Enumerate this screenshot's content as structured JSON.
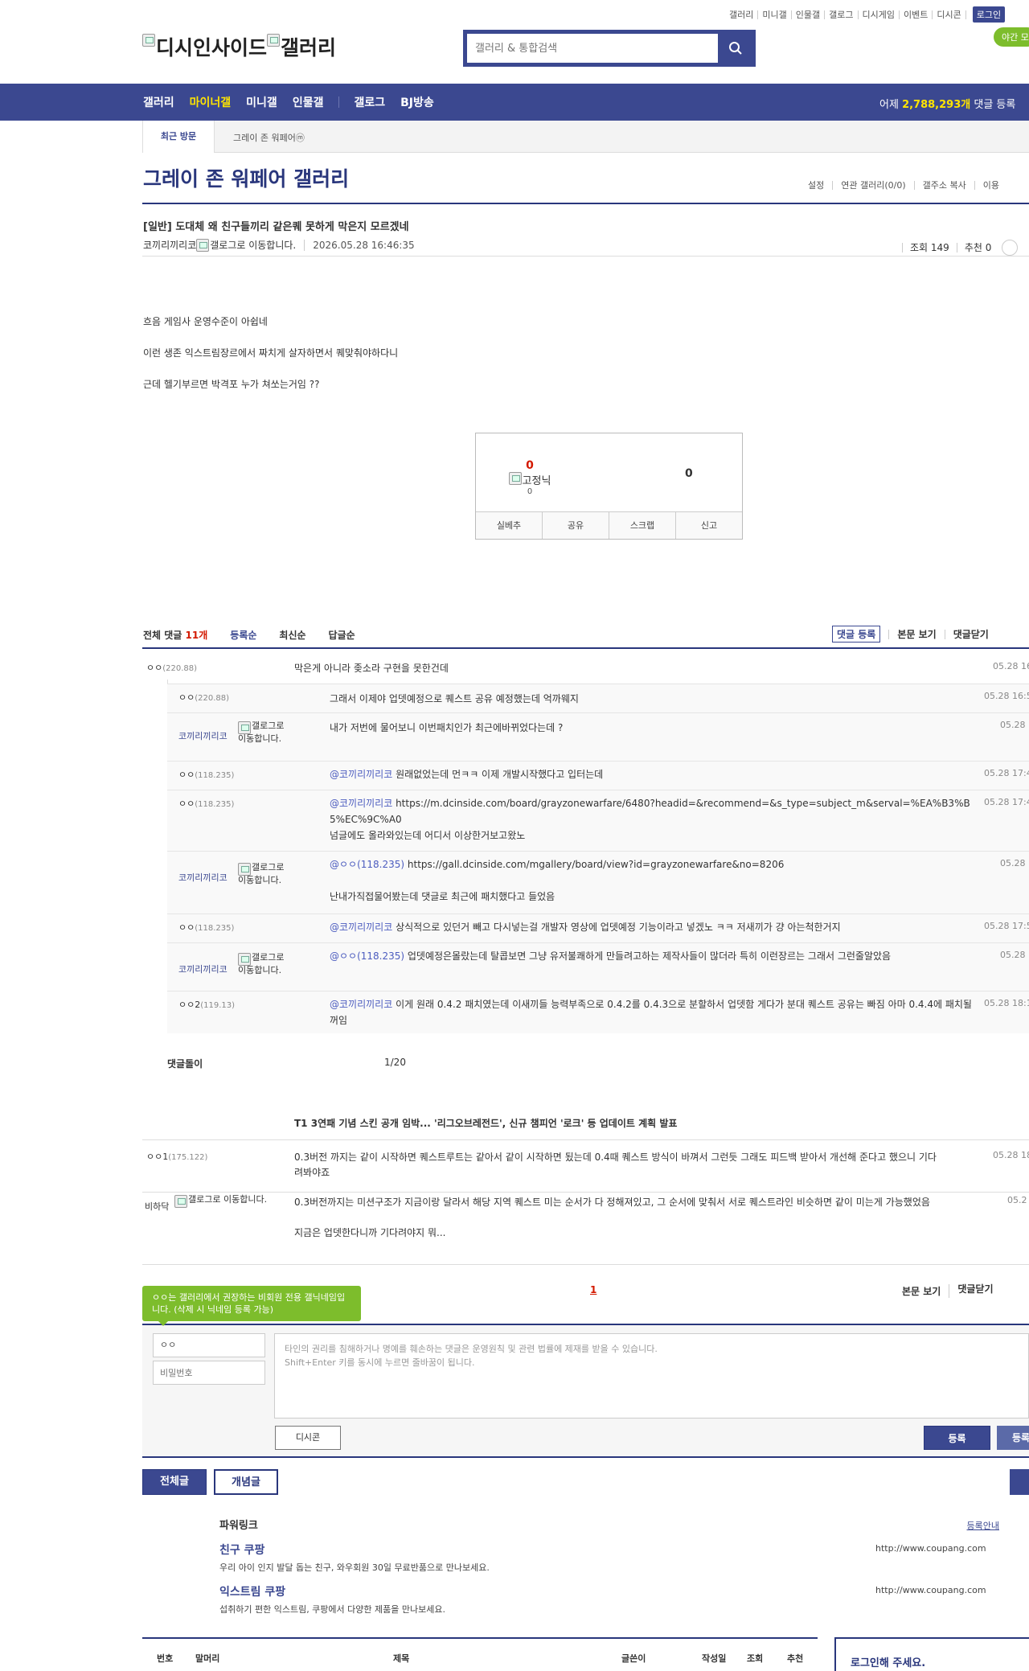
{
  "top_util": {
    "items": [
      "갤러리",
      "미니갤",
      "인물갤",
      "갤로그",
      "디시게임",
      "이벤트",
      "디시콘"
    ],
    "login": "로그인",
    "night_mode": "야간 모"
  },
  "logo": {
    "left_alt": "디시인사이드",
    "right_alt": "갤러리"
  },
  "search": {
    "placeholder": "갤러리 & 통합검색"
  },
  "gnb": {
    "menu": [
      "갤러리",
      "마이너갤",
      "미니갤",
      "인물갤",
      "갤로그",
      "BJ방송"
    ],
    "stats_prefix": "어제",
    "stats_count": "2,788,293개",
    "stats_suffix": "댓글 등록"
  },
  "recent_visit": {
    "title": "최근 방문",
    "item": "그레이 존 워페어ⓜ"
  },
  "gallery": {
    "title": "그레이 존 워페어 갤러리",
    "options": [
      "설정",
      "연관 갤러리(0/0)",
      "갤주소 복사",
      "이용"
    ]
  },
  "post": {
    "title": "[일반] 도대체 왜 친구들끼리 같은퀘 못하게 막은지 모르겠네",
    "author": "코끼리끼리코",
    "gallog_alt": "갤로그로 이동합니다.",
    "date": "2026.05.28 16:46:35",
    "views": "조회 149",
    "recommend": "추천 0",
    "body": [
      "흐음 게임사 운영수준이 아쉽네",
      "이런 생존 익스트림장르에서 짜치게 살자하면서 퀘맞춰야하다니",
      "근데 헬기부르면 박격포 누가 쳐쏘는거임 ??"
    ]
  },
  "recommend_box": {
    "up_count": "0",
    "fixed_nick_alt": "고정닉",
    "fixed_count": "0",
    "down_count": "0",
    "buttons": [
      "실베추",
      "공유",
      "스크랩",
      "신고"
    ]
  },
  "comments_header": {
    "label": "전체 댓글",
    "count": "11개",
    "sorts": [
      "등록순",
      "최신순",
      "답글순"
    ],
    "register": "댓글 등록",
    "view_body": "본문 보기",
    "close": "댓글닫기"
  },
  "comments": [
    {
      "nick": "ㅇㅇ",
      "ip": "(220.88)",
      "text": "막은게 아니라 좆소라 구현을 못한건데",
      "date": "05.28 16"
    }
  ],
  "replies": [
    {
      "nick": "ㅇㅇ",
      "ip": "(220.88)",
      "member": false,
      "mention": "",
      "text": "그래서 이제야 업뎃예정으로 퀘스트 공유 예정했는데 억까웨지",
      "date": "05.28 16:5"
    },
    {
      "nick": "코끼리끼리코",
      "ip": "",
      "member": true,
      "mention": "",
      "text": "내가 저번에 물어보니 이번패치인가 최근에바뀌었다는데 ?",
      "date": "05.28"
    },
    {
      "nick": "ㅇㅇ",
      "ip": "(118.235)",
      "member": false,
      "mention": "@코끼리끼리코",
      "text": " 원래없었는데 먼ㅋㅋ 이제 개발시작했다고 입터는데",
      "date": "05.28 17:4"
    },
    {
      "nick": "ㅇㅇ",
      "ip": "(118.235)",
      "member": false,
      "mention": "@코끼리끼리코",
      "text": " https://m.dcinside.com/board/grayzonewarfare/6480?headid=&recommend=&s_type=subject_m&serval=%EA%B3%B5%EC%9C%A0",
      "text2": "넘글에도 올라와있는데 어디서 이상한거보고왔노",
      "date": "05.28 17:4"
    },
    {
      "nick": "코끼리끼리코",
      "ip": "",
      "member": true,
      "mention": "@ㅇㅇ(118.235)",
      "text": " https://gall.dcinside.com/mgallery/board/view?id=grayzonewarfare&no=8206",
      "text2": "난내가직접물어봤는데 댓글로 최근에 패치했다고 들었음",
      "date": "05.28"
    },
    {
      "nick": "ㅇㅇ",
      "ip": "(118.235)",
      "member": false,
      "mention": "@코끼리끼리코",
      "text": " 상식적으로 있던거 빼고 다시넣는걸 개발자 영상에 업뎃예정 기능이라고 넣겠노 ㅋㅋ 저새끼가 걍 아는척한거지",
      "date": "05.28 17:5"
    },
    {
      "nick": "코끼리끼리코",
      "ip": "",
      "member": true,
      "mention": "@ㅇㅇ(118.235)",
      "text": " 업뎃예정은몰랐는데 탈콥보면 그냥 유저불쾌하게 만들려고하는 제작사들이 많더라 특히 이런장르는 그래서 그런줄알았음",
      "date": "05.28"
    },
    {
      "nick": "ㅇㅇ2",
      "ip": "(119.13)",
      "member": false,
      "mention": "@코끼리끼리코",
      "text": " 이게 원래 0.4.2 패치였는데 이새끼들 능력부족으로 0.4.2를 0.4.3으로 분할하서 업뎃함 게다가 분대 퀘스트 공유는 빠짐 아마 0.4.4에 패치될꺼임",
      "date": "05.28 18:1"
    }
  ],
  "dolly": {
    "label": "댓글돌이",
    "page": "1/20"
  },
  "news": {
    "title": "T1 3연패 기념 스킨 공개 임박... '리그오브레전드', 신규 챔피언 '로크' 등 업데이트 계획 발표"
  },
  "comments2": [
    {
      "nick": "ㅇㅇ1",
      "ip": "(175.122)",
      "text": "0.3버전 까지는 같이 시작하면 퀘스트루트는 같아서 같이 시작하면 됬는데 0.4때 퀘스트 방식이 바껴서 그런듯 그래도 피드백 받아서 개선해 준다고 했으니 기다려봐야죠",
      "date": "05.28 18"
    },
    {
      "nick": "비하닥",
      "ip": "",
      "gallog_alt": "갤로그로 이동합니다.",
      "text": "0.3버전까지는 미션구조가 지금이랑 달라서 해당 지역 퀘스트 미는 순서가 다 정해져있고, 그 순서에 맞춰서 서로 퀘스트라인 비슷하면 같이 미는게 가능했었음",
      "text2": "지금은 업뎃한다니까 기다려야지 뭐...",
      "date": "05.2"
    }
  ],
  "pagination": {
    "current": "1"
  },
  "bottom_tools": {
    "view_body": "본문 보기",
    "close": "댓글닫기"
  },
  "tip": {
    "text": "ㅇㅇ는 갤러리에서 권장하는 비회원 전용 갤닉네임입니다. (삭제 시 닉네임 등록 가능)"
  },
  "comment_form": {
    "nick_value": "ㅇㅇ",
    "password_placeholder": "비밀번호",
    "textarea_placeholder_1": "타인의 권리를 침해하거나 명예를 훼손하는 댓글은 운영원칙 및 관련 법률에 제재를 받을 수 있습니다.",
    "textarea_placeholder_2": "Shift+Enter 키를 동시에 누르면 줄바꿈이 됩니다.",
    "dccon": "디시콘",
    "register": "등록",
    "register2": "등록"
  },
  "list_tabs": {
    "all": "전체글",
    "concept": "개념글"
  },
  "powerlink": {
    "title": "파워링크",
    "guide": "등록안내",
    "ads": [
      {
        "title": "친구 쿠팡",
        "desc": "우리 아이 인지 발달 돕는 친구, 와우회원 30일 무료반품으로 만나보세요.",
        "url": "http://www.coupang.com"
      },
      {
        "title": "익스트림 쿠팡",
        "desc": "섭취하기 편한 익스트림, 쿠팡에서 다양한 제품을 만나보세요.",
        "url": "http://www.coupang.com"
      }
    ]
  },
  "list_header": [
    "번호",
    "말머리",
    "제목",
    "글쓴이",
    "작성일",
    "조회",
    "추천"
  ],
  "login_box": {
    "text": "로그인해 주세요."
  }
}
